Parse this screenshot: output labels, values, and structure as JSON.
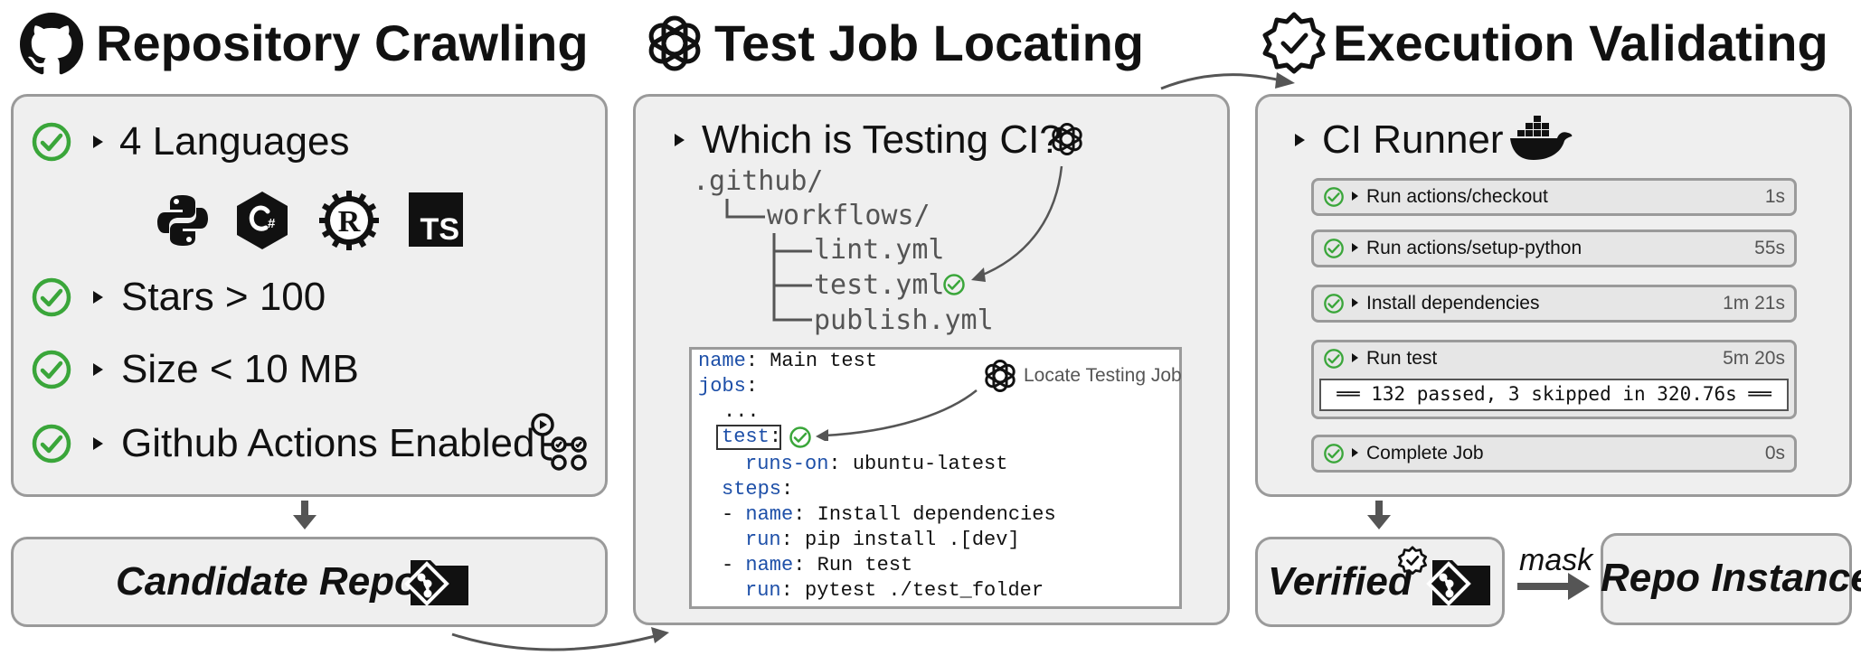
{
  "sections": {
    "crawl_title": "Repository Crawling",
    "locate_title": "Test Job Locating",
    "validate_title": "Execution Validating"
  },
  "crawl": {
    "items": [
      "4 Languages",
      "Stars > 100",
      "Size < 10 MB",
      "Github Actions Enabled"
    ],
    "language_icons": [
      "python-logo",
      "csharp-logo",
      "rust-logo",
      "typescript-logo"
    ],
    "ts_text": "TS",
    "candidate_label": "Candidate Repos"
  },
  "locate": {
    "question": "Which is Testing CI?",
    "tree": [
      ".github/",
      "workflows/",
      "lint.yml",
      "test.yml",
      "publish.yml"
    ],
    "locate_label": "Locate Testing Job",
    "code": {
      "l1_key": "name",
      "l1_val": ": Main test",
      "l2_key": "jobs",
      "l2_val": ":",
      "l3": "...",
      "l4_key": "test",
      "l4_val": ":",
      "l5_key": "runs-on",
      "l5_val": ": ubuntu-latest",
      "l6_key": "steps",
      "l6_val": ":",
      "l7_pre": "- ",
      "l7_key": "name",
      "l7_val": ": Install dependencies",
      "l8_key": "run",
      "l8_val": ": pip install .[dev]",
      "l9_pre": "- ",
      "l9_key": "name",
      "l9_val": ": Run test",
      "l10_key": "run",
      "l10_val": ": pytest ./test_folder"
    }
  },
  "validate": {
    "runner_label": "CI Runner",
    "steps": [
      {
        "label": "Run actions/checkout",
        "time": "1s"
      },
      {
        "label": "Run actions/setup-python",
        "time": "55s"
      },
      {
        "label": "Install dependencies",
        "time": "1m 21s"
      },
      {
        "label": "Run test",
        "time": "5m 20s"
      },
      {
        "label": "Complete Job",
        "time": "0s"
      }
    ],
    "test_output": "══ 132 passed, 3 skipped in 320.76s ══",
    "verified_label": "Verified",
    "mask_label": "mask",
    "instance_label": "Repo Instance"
  },
  "colors": {
    "check_green": "#3aa63a",
    "panel_bg": "#efefef",
    "border": "#9a9a9a",
    "keyword_blue": "#1d4fa8",
    "arrow": "#555555"
  }
}
